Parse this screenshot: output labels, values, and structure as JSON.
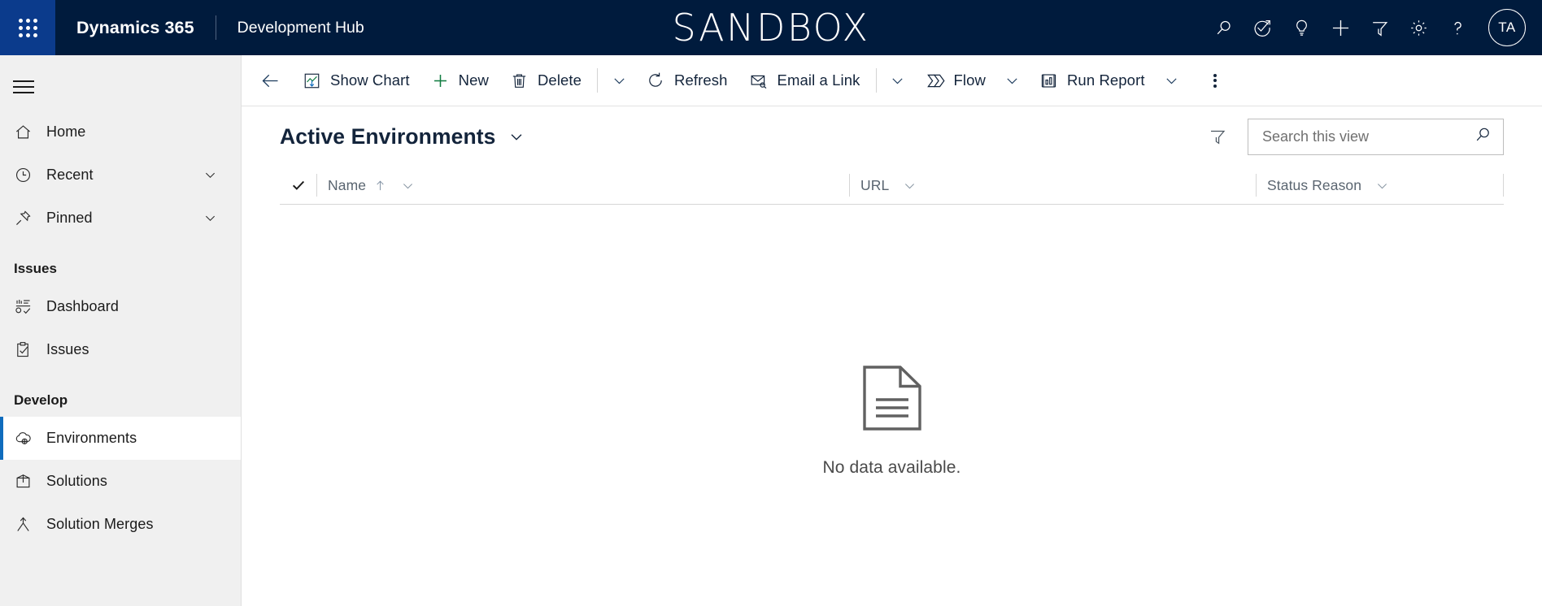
{
  "topnav": {
    "waffle_label": "App launcher",
    "brand": "Dynamics 365",
    "app_name": "Development Hub",
    "environment_banner": "SANDBOX",
    "background_color": "#001b3d",
    "waffle_color": "#0b3b8c",
    "icons": [
      {
        "name": "search-icon",
        "label": "Search"
      },
      {
        "name": "focus-assistant-icon",
        "label": "Assistant"
      },
      {
        "name": "lightbulb-icon",
        "label": "Ideas"
      },
      {
        "name": "plus-icon",
        "label": "Quick create"
      },
      {
        "name": "filter-icon",
        "label": "Filter"
      },
      {
        "name": "gear-icon",
        "label": "Settings"
      },
      {
        "name": "help-icon",
        "label": "Help"
      }
    ],
    "avatar_initials": "TA"
  },
  "sidebar": {
    "hamburger_label": "Site map",
    "items": [
      {
        "label": "Home",
        "icon": "home-icon",
        "chevron": false,
        "selected": false
      },
      {
        "label": "Recent",
        "icon": "clock-icon",
        "chevron": true,
        "selected": false
      },
      {
        "label": "Pinned",
        "icon": "pin-icon",
        "chevron": true,
        "selected": false
      }
    ],
    "groups": [
      {
        "title": "Issues",
        "items": [
          {
            "label": "Issues",
            "icon": "clipboard-check-icon",
            "selected": false
          },
          {
            "label": "Dashboard",
            "icon": "dashboard-icon",
            "selected": false
          }
        ]
      },
      {
        "title": "Develop",
        "items": [
          {
            "label": "Environments",
            "icon": "cloud-icon",
            "selected": true
          },
          {
            "label": "Solutions",
            "icon": "box-icon",
            "selected": false
          },
          {
            "label": "Solution Merges",
            "icon": "merge-icon",
            "selected": false
          }
        ]
      }
    ],
    "group_issues_title": "Issues",
    "group_develop_title": "Develop",
    "item_home": "Home",
    "item_recent": "Recent",
    "item_pinned": "Pinned",
    "item_dashboard": "Dashboard",
    "item_issues": "Issues",
    "item_environments": "Environments",
    "item_solutions": "Solutions",
    "item_solution_merges": "Solution Merges",
    "selected_item": "Environments",
    "selected_accent_color": "#0f6cbd",
    "background_color": "#f0f0f0"
  },
  "commandbar": {
    "back_label": "Back",
    "show_chart": "Show Chart",
    "new": "New",
    "delete": "Delete",
    "refresh": "Refresh",
    "email_a_link": "Email a Link",
    "flow": "Flow",
    "run_report": "Run Report",
    "more_commands_label": "More commands",
    "new_icon_color": "#107c41"
  },
  "view": {
    "title": "Active Environments",
    "filter_label": "Edit filters",
    "search": {
      "placeholder": "Search this view",
      "value": ""
    }
  },
  "grid": {
    "select_all_label": "Select all",
    "columns": [
      {
        "label": "Name",
        "sorted": "asc"
      },
      {
        "label": "URL",
        "sorted": ""
      },
      {
        "label": "Status Reason",
        "sorted": ""
      }
    ],
    "column_name": "Name",
    "column_url": "URL",
    "column_status_reason": "Status Reason",
    "rows": [],
    "empty_message": "No data available."
  }
}
